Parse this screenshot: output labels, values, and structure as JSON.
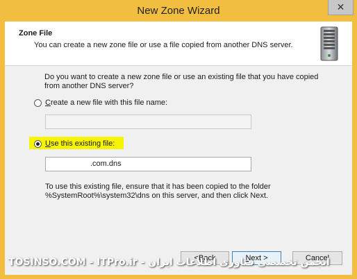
{
  "window": {
    "title": "New Zone Wizard",
    "close_glyph": "✕"
  },
  "header": {
    "title": "Zone File",
    "subtitle": "You can create a new zone file or use a file copied from another DNS server.",
    "icon": "server-icon"
  },
  "body": {
    "question": "Do you want to create a new zone file or use an existing file that you have copied from another DNS server?",
    "option_new": {
      "prefix": "",
      "mnemonic": "C",
      "rest": "reate a new file with this file name:",
      "selected": false,
      "value": ""
    },
    "option_existing": {
      "mnemonic": "U",
      "rest": "se this existing file:",
      "selected": true,
      "value": ".com.dns"
    },
    "info": "To use this existing file, ensure that it has been copied to the folder %SystemRoot%\\system32\\dns on this server, and then click Next."
  },
  "buttons": {
    "back_mnemonic": "< ",
    "back_u": "B",
    "back_rest": "ack",
    "next_u": "N",
    "next_rest": "ext >",
    "cancel": "Cancel"
  },
  "watermark": "TOSINSO.COM - ITPro.ir - انجمن تخصصی فناوری اطلاعات ایران"
}
